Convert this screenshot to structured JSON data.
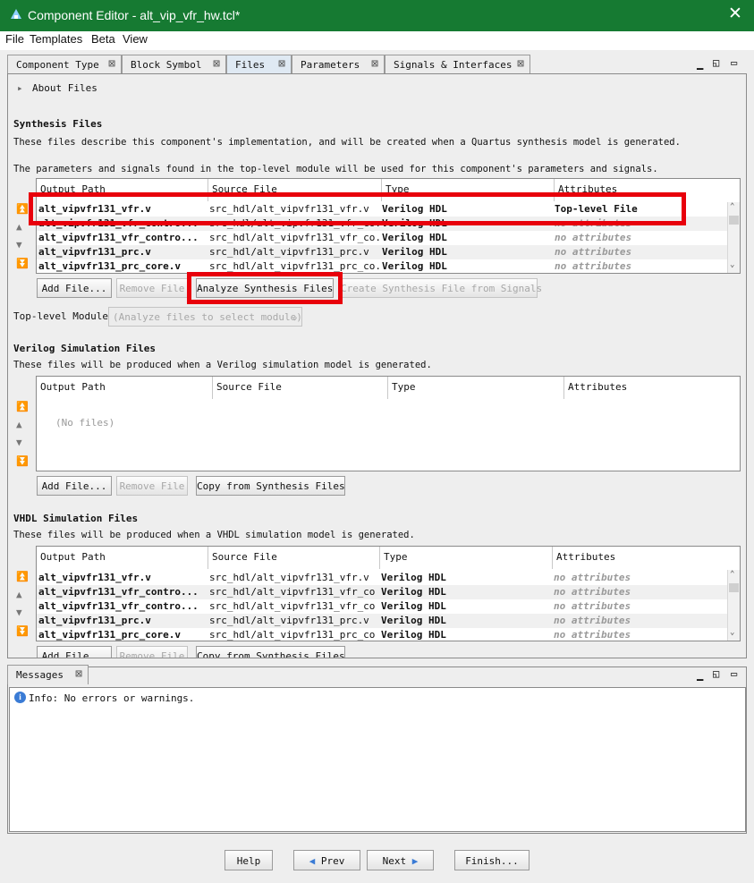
{
  "window": {
    "title": "Component Editor - alt_vip_vfr_hw.tcl*",
    "close_glyph": "✕"
  },
  "menu": [
    "File",
    "Templates",
    "Beta",
    "View"
  ],
  "tabs": [
    {
      "label": "Component Type",
      "x": "⊠"
    },
    {
      "label": "Block Symbol",
      "x": "⊠"
    },
    {
      "label": "Files",
      "x": "⊠"
    },
    {
      "label": "Parameters",
      "x": "⊠"
    },
    {
      "label": "Signals & Interfaces",
      "x": "⊠"
    }
  ],
  "about": {
    "arrow": "▸",
    "label": "About Files"
  },
  "synthesis": {
    "heading": "Synthesis Files",
    "desc1": "These files describe this component's implementation, and will be created when a Quartus synthesis model is generated.",
    "desc2": "The parameters and signals found in the top-level module will be used for this component's parameters and signals.",
    "columns": [
      "Output Path",
      "Source File",
      "Type",
      "Attributes"
    ],
    "rows": [
      {
        "out": "alt_vipvfr131_vfr.v",
        "src": "src_hdl/alt_vipvfr131_vfr.v",
        "type": "Verilog HDL",
        "attr": "Top-level File"
      },
      {
        "out": "alt_vipvfr131_vfr_contro...",
        "src": "src_hdl/alt_vipvfr131_vfr_co...",
        "type": "Verilog HDL",
        "attr": "no attributes"
      },
      {
        "out": "alt_vipvfr131_vfr_contro...",
        "src": "src_hdl/alt_vipvfr131_vfr_co...",
        "type": "Verilog HDL",
        "attr": "no attributes"
      },
      {
        "out": "alt_vipvfr131_prc.v",
        "src": "src_hdl/alt_vipvfr131_prc.v",
        "type": "Verilog HDL",
        "attr": "no attributes"
      },
      {
        "out": "alt_vipvfr131_prc_core.v",
        "src": "src_hdl/alt_vipvfr131_prc_co...",
        "type": "Verilog HDL",
        "attr": "no attributes"
      }
    ],
    "buttons": {
      "add": "Add File...",
      "remove": "Remove File",
      "analyze": "Analyze Synthesis Files",
      "create": "Create Synthesis File from Signals"
    },
    "toplevel_label": "Top-level Module:",
    "toplevel_placeholder": "(Analyze files to select module)"
  },
  "verilog": {
    "heading": "Verilog Simulation Files",
    "desc": "These files will be produced when a Verilog simulation model is generated.",
    "columns": [
      "Output Path",
      "Source File",
      "Type",
      "Attributes"
    ],
    "empty": "(No files)",
    "buttons": {
      "add": "Add File...",
      "remove": "Remove File",
      "copy": "Copy from Synthesis Files"
    }
  },
  "vhdl": {
    "heading": "VHDL Simulation Files",
    "desc": "These files will be produced when a VHDL simulation model is generated.",
    "columns": [
      "Output Path",
      "Source File",
      "Type",
      "Attributes"
    ],
    "rows": [
      {
        "out": "alt_vipvfr131_vfr.v",
        "src": "src_hdl/alt_vipvfr131_vfr.v",
        "type": "Verilog HDL",
        "attr": "no attributes"
      },
      {
        "out": "alt_vipvfr131_vfr_contro...",
        "src": "src_hdl/alt_vipvfr131_vfr_co...",
        "type": "Verilog HDL",
        "attr": "no attributes"
      },
      {
        "out": "alt_vipvfr131_vfr_contro...",
        "src": "src_hdl/alt_vipvfr131_vfr_co...",
        "type": "Verilog HDL",
        "attr": "no attributes"
      },
      {
        "out": "alt_vipvfr131_prc.v",
        "src": "src_hdl/alt_vipvfr131_prc.v",
        "type": "Verilog HDL",
        "attr": "no attributes"
      },
      {
        "out": "alt_vipvfr131_prc_core.v",
        "src": "src_hdl/alt_vipvfr131_prc_co...",
        "type": "Verilog HDL",
        "attr": "no attributes"
      }
    ],
    "buttons": {
      "add": "Add File...",
      "remove": "Remove File",
      "copy": "Copy from Synthesis Files"
    }
  },
  "messages": {
    "tab": "Messages",
    "tab_x": "⊠",
    "text": "Info: No errors or warnings."
  },
  "nav": {
    "help": "Help",
    "prev": "Prev",
    "next": "Next",
    "finish": "Finish..."
  },
  "colors": {
    "titlebar": "#167a32",
    "highlight": "#e8000b",
    "info": "#3a7bd5"
  }
}
